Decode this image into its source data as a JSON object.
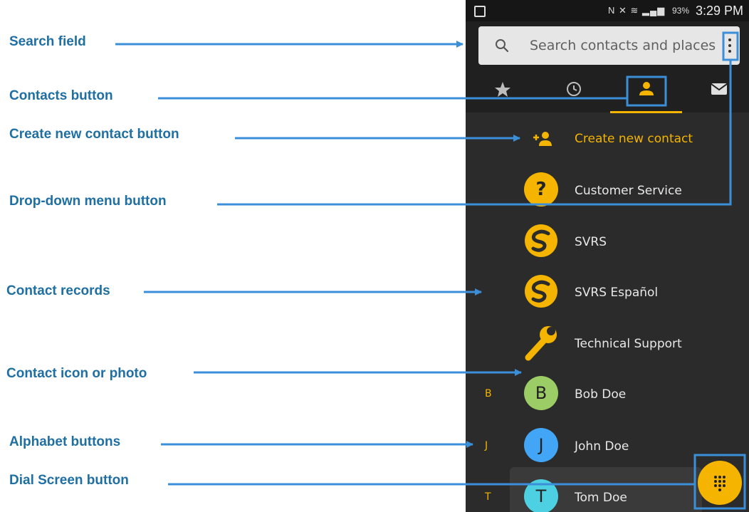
{
  "annotations": {
    "search_field": "Search field",
    "contacts_button": "Contacts button",
    "create_new_contact_button": "Create new contact button",
    "drop_down_menu_button": "Drop-down menu button",
    "contact_records": "Contact records",
    "contact_icon_or_photo": "Contact icon or photo",
    "alphabet_buttons": "Alphabet buttons",
    "dial_screen_button": "Dial Screen button"
  },
  "status_bar": {
    "battery": "93%",
    "time": "3:29 PM"
  },
  "search": {
    "placeholder": "Search contacts and places"
  },
  "tabs": [
    {
      "icon": "star-icon"
    },
    {
      "icon": "clock-icon"
    },
    {
      "icon": "person-icon",
      "selected": true
    },
    {
      "icon": "mail-icon"
    }
  ],
  "list": {
    "create_label": "Create new contact",
    "contacts": [
      {
        "name": "Customer Service",
        "icon": "question-icon"
      },
      {
        "name": "SVRS",
        "icon": "svrs-logo-icon"
      },
      {
        "name": "SVRS Español",
        "icon": "svrs-logo-icon"
      },
      {
        "name": "Technical Support",
        "icon": "wrench-icon"
      },
      {
        "name": "Bob Doe",
        "initial": "B",
        "alpha": "B",
        "avatar_color": "#9ccc65"
      },
      {
        "name": "John Doe",
        "initial": "J",
        "alpha": "J",
        "avatar_color": "#42a5f5"
      },
      {
        "name": "Tom Doe",
        "initial": "T",
        "alpha": "T",
        "avatar_color": "#4dd0e1"
      }
    ]
  },
  "colors": {
    "accent": "#f4b400",
    "annotation": "#1f6fa3",
    "arrow": "#3b8fd8"
  }
}
